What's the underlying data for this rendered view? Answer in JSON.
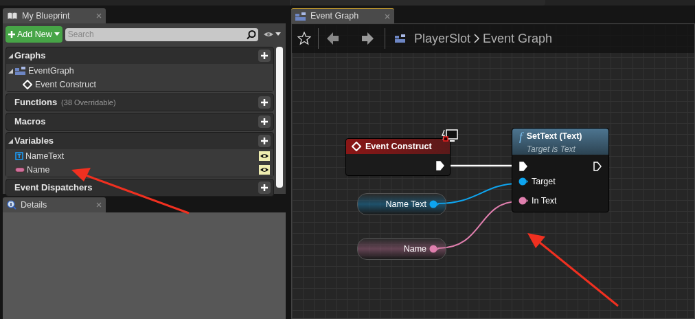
{
  "my_blueprint": {
    "tab": "My Blueprint",
    "add_new": "Add New",
    "search": {
      "placeholder": "Search"
    },
    "sections": [
      {
        "title": "Graphs",
        "expanded": true,
        "children": [
          {
            "label": "EventGraph",
            "kind": "graph",
            "expanded": true,
            "children": [
              {
                "label": "Event Construct",
                "kind": "event"
              }
            ]
          }
        ]
      },
      {
        "title": "Functions",
        "note": "(38 Overridable)",
        "expanded": false
      },
      {
        "title": "Macros",
        "expanded": false
      },
      {
        "title": "Variables",
        "expanded": true,
        "children": [
          {
            "label": "NameText",
            "kind": "widget",
            "public": true
          },
          {
            "label": "Name",
            "kind": "text",
            "public": true
          }
        ]
      },
      {
        "title": "Event Dispatchers",
        "expanded": false
      }
    ]
  },
  "details": {
    "tab": "Details"
  },
  "graph": {
    "tab": "Event Graph",
    "breadcrumb": [
      "PlayerSlot",
      "Event Graph"
    ],
    "event_node": {
      "title": "Event Construct"
    },
    "function_node": {
      "icon": "f",
      "title": "SetText (Text)",
      "subtitle": "Target is Text",
      "pins": [
        {
          "label": "Target",
          "color": "#0ea5f0"
        },
        {
          "label": "In Text",
          "color": "#e07fae"
        }
      ]
    },
    "variable_nodes": [
      {
        "label": "Name Text",
        "color": "#0ea5f0"
      },
      {
        "label": "Name",
        "color": "#e07fae"
      }
    ]
  }
}
